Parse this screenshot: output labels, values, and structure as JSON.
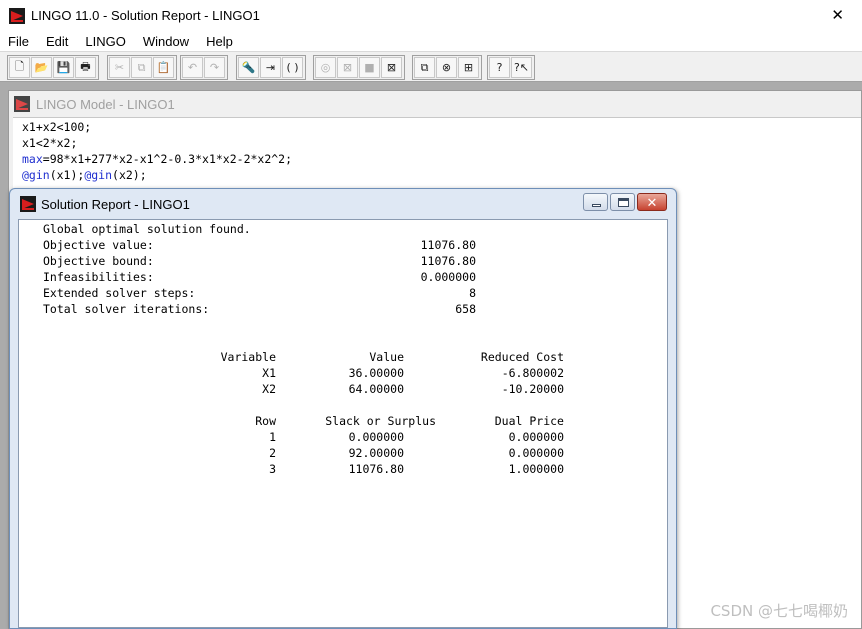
{
  "window": {
    "title": "LINGO 11.0 - Solution Report - LINGO1",
    "close_glyph": "✕"
  },
  "menu": [
    "File",
    "Edit",
    "LINGO",
    "Window",
    "Help"
  ],
  "toolbar": {
    "groups": [
      [
        {
          "name": "new-icon",
          "glyph": "🗋"
        },
        {
          "name": "open-icon",
          "glyph": "📂"
        },
        {
          "name": "save-icon",
          "glyph": "💾"
        },
        {
          "name": "print-icon",
          "glyph": "🖶"
        }
      ],
      [
        {
          "name": "cut-icon",
          "glyph": "✂",
          "disabled": true
        },
        {
          "name": "copy-icon",
          "glyph": "⧉",
          "disabled": true
        },
        {
          "name": "paste-icon",
          "glyph": "📋"
        }
      ],
      [
        {
          "name": "undo-icon",
          "glyph": "↶",
          "disabled": true
        },
        {
          "name": "redo-icon",
          "glyph": "↷",
          "disabled": true
        }
      ],
      [
        {
          "name": "find-icon",
          "glyph": "🔦"
        },
        {
          "name": "goto-line-icon",
          "glyph": "⇥"
        },
        {
          "name": "match-paren-icon",
          "glyph": "( )"
        }
      ],
      [
        {
          "name": "solve-icon",
          "glyph": "◎",
          "disabled": true
        },
        {
          "name": "solution-icon",
          "glyph": "⊠",
          "disabled": true
        },
        {
          "name": "interrupt-icon",
          "glyph": "■",
          "disabled": true
        },
        {
          "name": "close-all-icon",
          "glyph": "⊠"
        }
      ],
      [
        {
          "name": "send-to-back-icon",
          "glyph": "⧉"
        },
        {
          "name": "options-icon",
          "glyph": "⊗"
        },
        {
          "name": "tile-icon",
          "glyph": "⊞"
        }
      ],
      [
        {
          "name": "help-icon",
          "glyph": "?"
        },
        {
          "name": "context-help-icon",
          "glyph": "?↖"
        }
      ]
    ]
  },
  "model_window": {
    "title": "LINGO Model - LINGO1",
    "lines": [
      {
        "segments": [
          {
            "text": "x1+x2<100;",
            "kw": false
          }
        ]
      },
      {
        "segments": [
          {
            "text": "x1<2*x2;",
            "kw": false
          }
        ]
      },
      {
        "segments": [
          {
            "text": "max",
            "kw": true
          },
          {
            "text": "=98*x1+277*x2-x1^2-0.3*x1*x2-2*x2^2;",
            "kw": false
          }
        ]
      },
      {
        "segments": [
          {
            "text": "@gin",
            "kw": true
          },
          {
            "text": "(x1);",
            "kw": false
          },
          {
            "text": "@gin",
            "kw": true
          },
          {
            "text": "(x2);",
            "kw": false
          }
        ]
      }
    ]
  },
  "solution_window": {
    "title": "Solution Report - LINGO1",
    "status": "Global optimal solution found.",
    "stats": [
      {
        "label": "Objective value:",
        "value": "11076.80"
      },
      {
        "label": "Objective bound:",
        "value": "11076.80"
      },
      {
        "label": "Infeasibilities:",
        "value": "0.000000"
      },
      {
        "label": "Extended solver steps:",
        "value": "8"
      },
      {
        "label": "Total solver iterations:",
        "value": "658"
      }
    ],
    "variables": {
      "headers": [
        "Variable",
        "Value",
        "Reduced Cost"
      ],
      "rows": [
        [
          "X1",
          "36.00000",
          "-6.800002"
        ],
        [
          "X2",
          "64.00000",
          "-10.20000"
        ]
      ]
    },
    "rows_table": {
      "headers": [
        "Row",
        "Slack or Surplus",
        "Dual Price"
      ],
      "rows": [
        [
          "1",
          "0.000000",
          "0.000000"
        ],
        [
          "2",
          "92.00000",
          "0.000000"
        ],
        [
          "3",
          "11076.80",
          "1.000000"
        ]
      ]
    }
  },
  "watermark": "CSDN @七七喝椰奶"
}
